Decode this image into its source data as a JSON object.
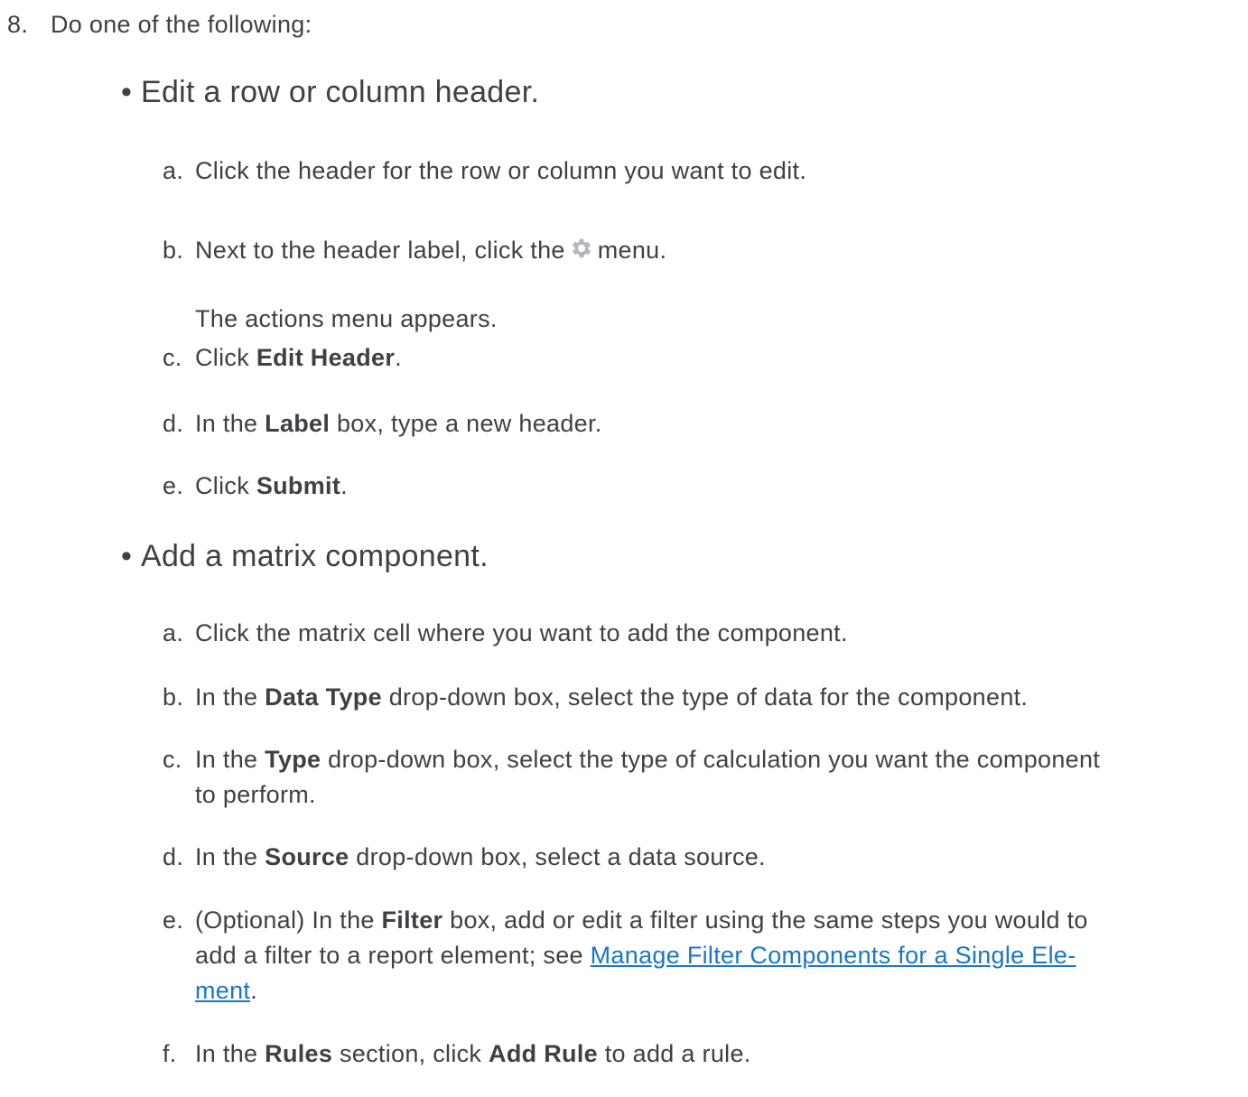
{
  "step": {
    "number": "8.",
    "text": "Do one of the following:"
  },
  "bullet1": {
    "title": "Edit a row or column header.",
    "items": {
      "a": {
        "letter": "a.",
        "text": "Click the header for the row or column you want to edit."
      },
      "b": {
        "letter": "b.",
        "pre": "Next to the header label, click the",
        "post": "menu.",
        "note": "The actions menu appears."
      },
      "c": {
        "letter": "c.",
        "pre": "Click ",
        "bold": "Edit Header",
        "post": "."
      },
      "d": {
        "letter": "d.",
        "pre": "In the ",
        "bold": "Label",
        "post": " box, type a new header."
      },
      "e": {
        "letter": "e.",
        "pre": "Click ",
        "bold": "Submit",
        "post": "."
      }
    }
  },
  "bullet2": {
    "title": "Add a matrix component.",
    "items": {
      "a": {
        "letter": "a.",
        "text": "Click the matrix cell where you want to add the component."
      },
      "b": {
        "letter": "b.",
        "pre": "In the ",
        "bold": "Data Type",
        "post": " drop-down box, select the type of data for the component."
      },
      "c": {
        "letter": "c.",
        "pre": "In the ",
        "bold": "Type",
        "post": " drop-down box, select the type of calculation you want the component",
        "cont": "to perform."
      },
      "d": {
        "letter": "d.",
        "pre": "In the ",
        "bold": "Source",
        "post": " drop-down box, select a data source."
      },
      "e": {
        "letter": "e.",
        "pre": "(Optional) In the ",
        "bold": "Filter",
        "post": " box, add or edit a filter using the same steps you would to",
        "line2_pre": "add a filter to a report element; see ",
        "link_part1": "Manage Filter Components for a Single Ele-",
        "link_part2": "ment",
        "line3_post": "."
      },
      "f": {
        "letter": "f.",
        "pre": "In the ",
        "bold": "Rules",
        "mid": " section, click ",
        "bold2": "Add Rule",
        "post": " to add a rule."
      }
    }
  },
  "colors": {
    "text": "#3f3f46",
    "link": "#1a76c6",
    "gear": "#b5b5bb"
  },
  "icons": {
    "gear": "gear-icon"
  }
}
